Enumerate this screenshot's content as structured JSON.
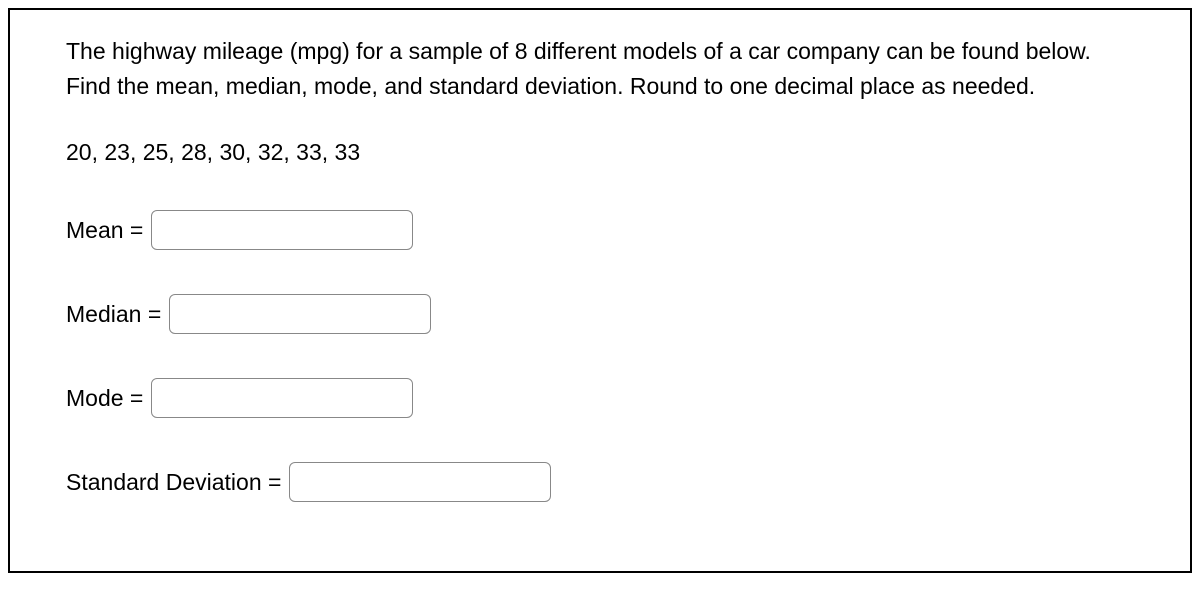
{
  "problem": {
    "description": "The highway mileage (mpg) for a sample of 8 different models of a car company can be found below. Find the mean, median, mode, and standard deviation. Round to one decimal place as needed.",
    "data": "20, 23, 25, 28, 30, 32, 33, 33"
  },
  "fields": {
    "mean": {
      "label": "Mean =",
      "value": ""
    },
    "median": {
      "label": "Median =",
      "value": ""
    },
    "mode": {
      "label": "Mode =",
      "value": ""
    },
    "stddev": {
      "label": "Standard Deviation =",
      "value": ""
    }
  }
}
